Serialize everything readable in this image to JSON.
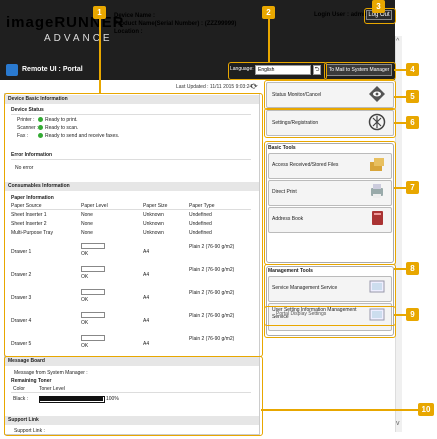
{
  "header": {
    "logo_main": "imageRUNNER",
    "logo_sub": "ADVANCE",
    "device_name_label": "Device Name :",
    "product_name_label": "Product Name(Serial Number) :",
    "product_serial": "(ZZZ99999)",
    "location_label": "Location :",
    "login_user_label": "Login User :",
    "login_user_value": "admin",
    "logout_label": "Log Out"
  },
  "subbar": {
    "title": "Remote UI : Portal",
    "language_label": "Language:",
    "language_value": "English",
    "system_manager_label": "To Mail to System Manager"
  },
  "status": {
    "last_updated": "Last Updated : 11/11 2015 9:03:24"
  },
  "device_basic": {
    "heading": "Device Basic Information",
    "device_status_title": "Device Status",
    "items": [
      {
        "label": "Printer :",
        "value": "Ready to print."
      },
      {
        "label": "Scanner :",
        "value": "Ready to scan."
      },
      {
        "label": "Fax :",
        "value": "Ready to send and receive faxes."
      }
    ],
    "error_title": "Error Information",
    "error_value": "No error"
  },
  "consumables": {
    "heading": "Consumables Information",
    "paper_title": "Paper Information",
    "columns": [
      "Paper Source",
      "Paper Level",
      "Paper Size",
      "Paper Type"
    ],
    "rows": [
      {
        "source": "Sheet Inserter 1",
        "level": "None",
        "size": "Unknown",
        "type": "Undefined"
      },
      {
        "source": "Sheet Inserter 2",
        "level": "None",
        "size": "Unknown",
        "type": "Undefined"
      },
      {
        "source": "Multi-Purpose Tray",
        "level": "None",
        "size": "Unknown",
        "type": "Undefined"
      },
      {
        "source": "Drawer 1",
        "level": "OK",
        "size": "A4",
        "type": "Plain 2 (76-90 g/m2)"
      },
      {
        "source": "Drawer 2",
        "level": "OK",
        "size": "A4",
        "type": "Plain 2 (76-90 g/m2)"
      },
      {
        "source": "Drawer 3",
        "level": "OK",
        "size": "A4",
        "type": "Plain 2 (76-90 g/m2)"
      },
      {
        "source": "Drawer 4",
        "level": "OK",
        "size": "A4",
        "type": "Plain 2 (76-90 g/m2)"
      },
      {
        "source": "Drawer 5",
        "level": "OK",
        "size": "A4",
        "type": "Plain 2 (76-90 g/m2)"
      }
    ],
    "toner_title": "Remaining Toner",
    "toner_columns": [
      "Color",
      "Toner Level"
    ],
    "toner_color": "Black :",
    "toner_percent": "100%",
    "toner_level": 1.0
  },
  "message_board": {
    "heading": "Message Board",
    "text": "Message from System Manager :"
  },
  "support": {
    "heading": "Support Link",
    "text": "Support Link :"
  },
  "right": {
    "status_monitor": "Status Monitor/Cancel",
    "settings": "Settings/Registration",
    "basic_tools_title": "Basic Tools",
    "basic_tools": [
      "Access Received/Stored Files",
      "Direct Print",
      "Address Book"
    ],
    "mgmt_tools_title": "Management Tools",
    "mgmt_tools": [
      "Service Management Service",
      "User Setting Information Management Service"
    ],
    "portal_display": "Portal Display Settings"
  },
  "callouts": [
    "1",
    "2",
    "3",
    "4",
    "5",
    "6",
    "7",
    "8",
    "9",
    "10"
  ],
  "colors": {
    "accent": "#e8a700",
    "header_bg": "#1f1f1f",
    "ok_green": "#33aa33"
  }
}
